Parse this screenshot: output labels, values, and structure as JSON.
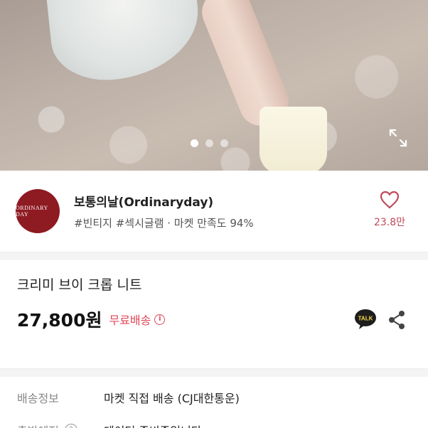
{
  "hero": {
    "carousel_dots": 3,
    "active_dot": 1,
    "expand_icon": "expand-icon"
  },
  "shop": {
    "logo_text": "ORDINARY DAY",
    "name": "보통의날(Ordinaryday)",
    "tags": "#빈티지 #섹시글램 · 마켓 만족도 94%",
    "like_count": "23.8만",
    "like_icon": "heart-icon"
  },
  "product": {
    "name": "크리미 브이 크롭 니트",
    "price": "27,800원",
    "shipping_badge": "무료배송",
    "info_icon": "info-icon",
    "talk_label": "TALK",
    "share_icon": "share-icon"
  },
  "shipping": {
    "rows": [
      {
        "label": "배송정보",
        "value": "마켓 직접 배송 (CJ대한통운)"
      },
      {
        "label": "출발예정",
        "value": "데이터 준비중입니다"
      }
    ]
  },
  "colors": {
    "accent": "#e0485a",
    "like": "#c04a5a",
    "logo_bg": "#8e1a22"
  }
}
